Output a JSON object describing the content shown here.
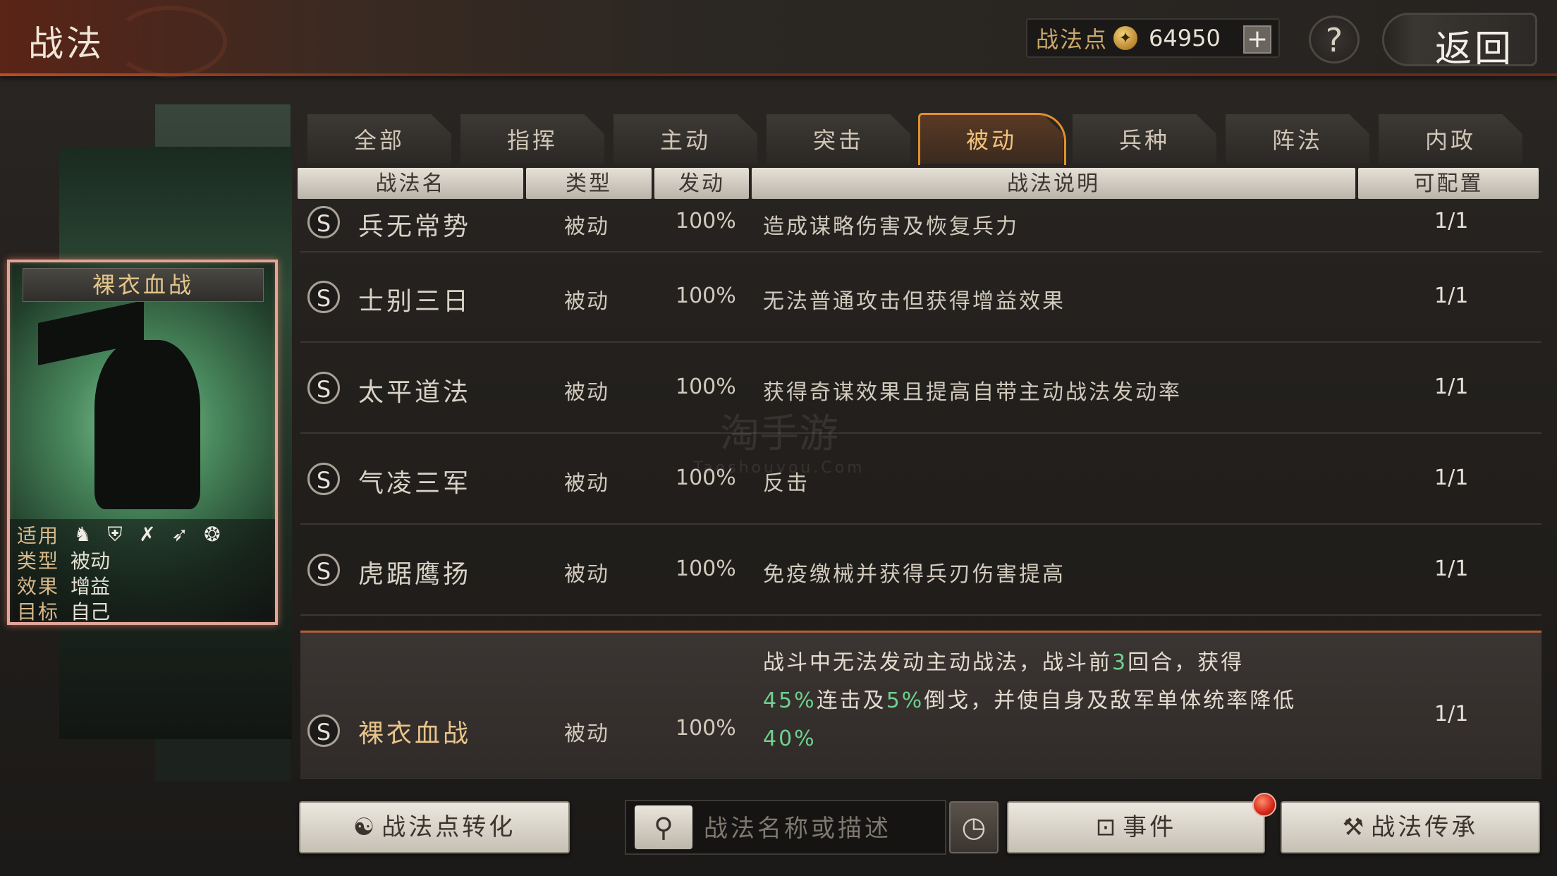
{
  "header": {
    "title": "战法",
    "points_label": "战法点",
    "points_value": "64950",
    "plus_label": "+",
    "help_label": "?",
    "back_label": "返回"
  },
  "card": {
    "name": "裸衣血战",
    "applicable_key": "适用",
    "type_key": "类型",
    "type_val": "被动",
    "effect_key": "效果",
    "effect_val": "增益",
    "target_key": "目标",
    "target_val": "自己",
    "unit_icons": [
      "cavalry-icon",
      "shield-icon",
      "bow-icon",
      "spear-icon",
      "siege-icon"
    ]
  },
  "tabs": [
    {
      "label": "全部"
    },
    {
      "label": "指挥"
    },
    {
      "label": "主动"
    },
    {
      "label": "突击"
    },
    {
      "label": "被动",
      "active": true
    },
    {
      "label": "兵种"
    },
    {
      "label": "阵法"
    },
    {
      "label": "内政"
    }
  ],
  "columns": {
    "name": "战法名",
    "type": "类型",
    "rate": "发动",
    "desc": "战法说明",
    "count": "可配置"
  },
  "rows": [
    {
      "grade": "S",
      "name": "兵无常势",
      "type": "被动",
      "rate": "100%",
      "desc": "造成谋略伤害及恢复兵力",
      "count": "1/1"
    },
    {
      "grade": "S",
      "name": "士别三日",
      "type": "被动",
      "rate": "100%",
      "desc": "无法普通攻击但获得增益效果",
      "count": "1/1"
    },
    {
      "grade": "S",
      "name": "太平道法",
      "type": "被动",
      "rate": "100%",
      "desc": "获得奇谋效果且提高自带主动战法发动率",
      "count": "1/1"
    },
    {
      "grade": "S",
      "name": "气凌三军",
      "type": "被动",
      "rate": "100%",
      "desc": "反击",
      "count": "1/1"
    },
    {
      "grade": "S",
      "name": "虎踞鹰扬",
      "type": "被动",
      "rate": "100%",
      "desc": "免疫缴械并获得兵刃伤害提高",
      "count": "1/1"
    }
  ],
  "selected_row": {
    "grade": "S",
    "name": "裸衣血战",
    "type": "被动",
    "rate": "100%",
    "count": "1/1",
    "desc_1a": "战斗中无法发动主动战法，战斗前",
    "desc_1b": "3",
    "desc_1c": "回合，获得",
    "desc_2a": "45%",
    "desc_2b": "连击及",
    "desc_2c": "5%",
    "desc_2d": "倒戈，并使自身及敌军单体统率降低",
    "desc_3": "40%"
  },
  "watermark": {
    "main": "淘手游",
    "sub": "Taoshouyou.Com"
  },
  "bottom": {
    "convert_label": "战法点转化",
    "search_placeholder": "战法名称或描述",
    "events_label": "事件",
    "inherit_label": "战法传承"
  },
  "colors": {
    "accent": "#e0902f",
    "highlight_green": "#6fd08f",
    "selected_border": "#e2a59a"
  }
}
